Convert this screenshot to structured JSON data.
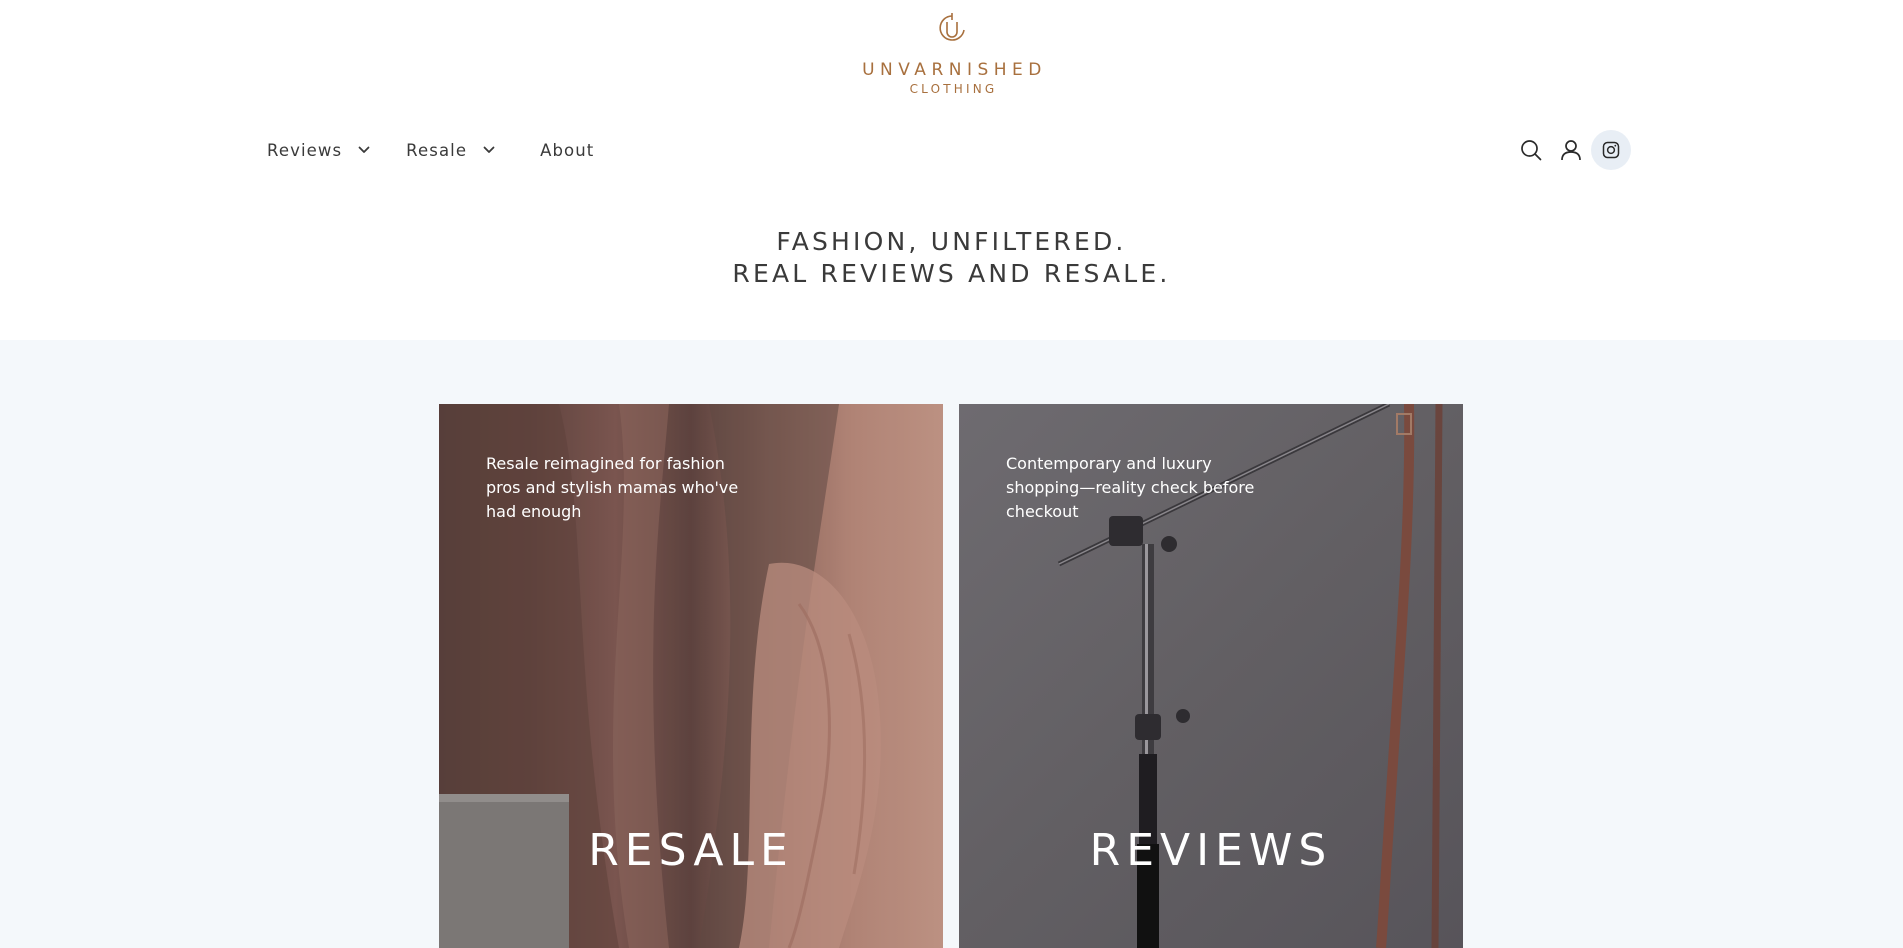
{
  "brand": {
    "name": "UNVARNISHED",
    "sub": "CLOTHING",
    "mark_letter": "U",
    "color": "#a8703e"
  },
  "nav": {
    "items": [
      {
        "label": "Reviews",
        "has_dropdown": true
      },
      {
        "label": "Resale",
        "has_dropdown": true
      },
      {
        "label": "About",
        "has_dropdown": false
      }
    ]
  },
  "header_icons": [
    "search-icon",
    "account-icon",
    "instagram-icon"
  ],
  "hero": {
    "line1": "FASHION, UNFILTERED.",
    "line2": "REAL REVIEWS AND RESALE."
  },
  "cards": [
    {
      "description": "Resale reimagined for fashion pros and stylish mamas who've had enough",
      "title": "RESALE"
    },
    {
      "description": "Contemporary and luxury shopping—reality check before checkout",
      "title": "REVIEWS"
    }
  ],
  "colors": {
    "text": "#3a3a3a",
    "section_bg": "#f4f8fb",
    "instagram_bg": "#e8eef5"
  }
}
